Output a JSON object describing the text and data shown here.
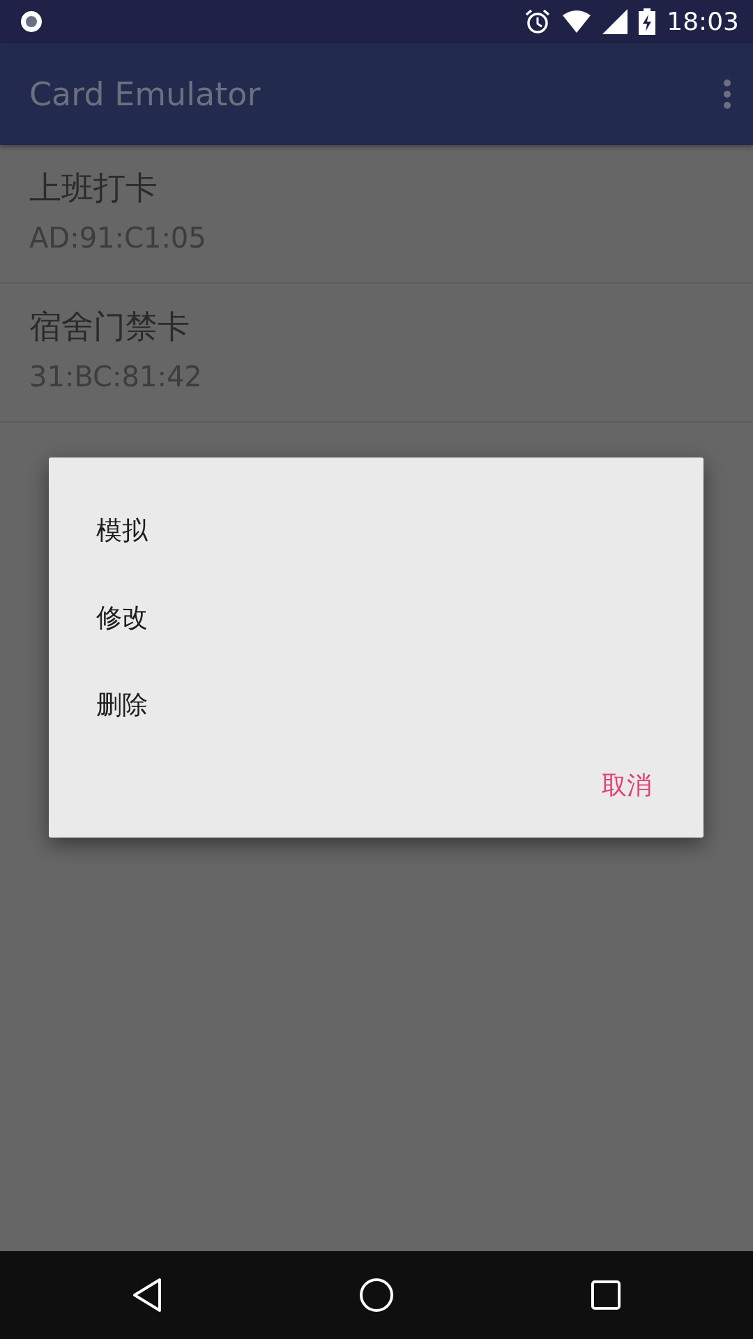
{
  "status_bar": {
    "time": "18:03"
  },
  "app_bar": {
    "title": "Card Emulator"
  },
  "cards": [
    {
      "name": "上班打卡",
      "uid": "AD:91:C1:05"
    },
    {
      "name": "宿舍门禁卡",
      "uid": "31:BC:81:42"
    }
  ],
  "dialog": {
    "options": [
      "模拟",
      "修改",
      "删除"
    ],
    "cancel": "取消"
  }
}
